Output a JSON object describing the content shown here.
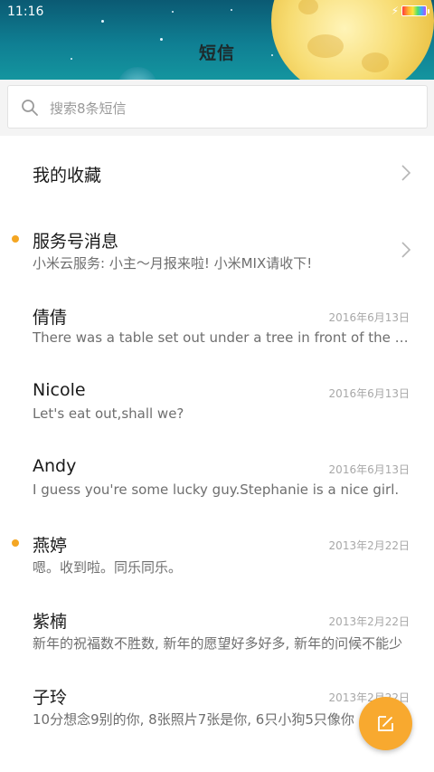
{
  "status_bar": {
    "time": "11:16"
  },
  "header": {
    "title": "短信"
  },
  "search": {
    "placeholder": "搜索8条短信"
  },
  "favorites": {
    "label": "我的收藏"
  },
  "service": {
    "name": "服务号消息",
    "preview": "小米云服务: 小主～月报来啦! 小米MIX请收下!",
    "unread": true
  },
  "threads": [
    {
      "name": "倩倩",
      "date": "2016年6月13日",
      "preview": "There was a table set out under a tree in front of the house, and the March Hare and the Hatter were having tea at it",
      "unread": false
    },
    {
      "name": "Nicole",
      "date": "2016年6月13日",
      "preview": "Let's eat out,shall we?",
      "unread": false
    },
    {
      "name": "Andy",
      "date": "2016年6月13日",
      "preview": "I guess you're some lucky guy.Stephanie is a nice girl.",
      "unread": false
    },
    {
      "name": "燕婷",
      "date": "2013年2月22日",
      "preview": "嗯。收到啦。同乐同乐。",
      "unread": true
    },
    {
      "name": "紫楠",
      "date": "2013年2月22日",
      "preview": "新年的祝福数不胜数, 新年的愿望好多好多, 新年的问候不能少",
      "unread": false
    },
    {
      "name": "子玲",
      "date": "2013年2月22日",
      "preview": "10分想念9别的你, 8张照片7张是你, 6只小狗5只像你",
      "unread": false
    }
  ],
  "colors": {
    "accent": "#f8a92f",
    "unread_dot": "#f4a623",
    "header_top": "#0b5a73",
    "header_bottom": "#14959f"
  },
  "icons": {
    "search": "search-icon",
    "compose": "compose-icon",
    "chevron": "chevron-right-icon"
  }
}
